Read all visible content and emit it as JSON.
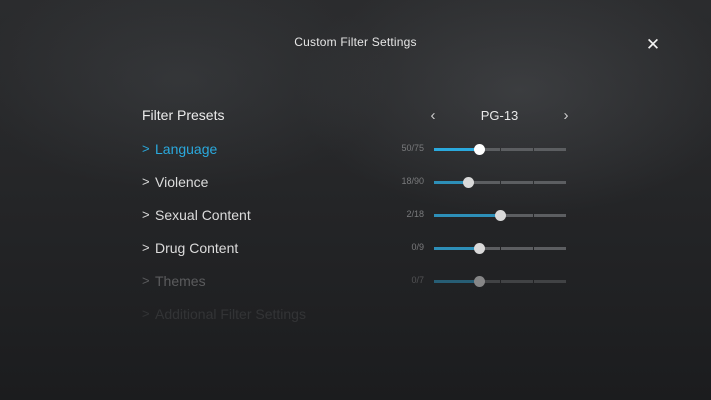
{
  "header": {
    "title": "Custom Filter Settings",
    "close_icon": "close-icon"
  },
  "presets": {
    "label": "Filter Presets",
    "value": "PG-13",
    "prev_icon": "chevron-left-icon",
    "next_icon": "chevron-right-icon"
  },
  "colors": {
    "accent": "#2aa9dd",
    "track": "#5c5e61",
    "text": "#dcdcdc"
  },
  "filters": [
    {
      "label": "Language",
      "count": "50/75",
      "level": 0.34,
      "state": "active"
    },
    {
      "label": "Violence",
      "count": "18/90",
      "level": 0.26,
      "state": "normal"
    },
    {
      "label": "Sexual Content",
      "count": "2/18",
      "level": 0.5,
      "state": "normal"
    },
    {
      "label": "Drug Content",
      "count": "0/9",
      "level": 0.34,
      "state": "normal"
    },
    {
      "label": "Themes",
      "count": "0/7",
      "level": 0.34,
      "state": "faded"
    },
    {
      "label": "Additional Filter Settings",
      "count": "",
      "level": null,
      "state": "ghost"
    }
  ]
}
